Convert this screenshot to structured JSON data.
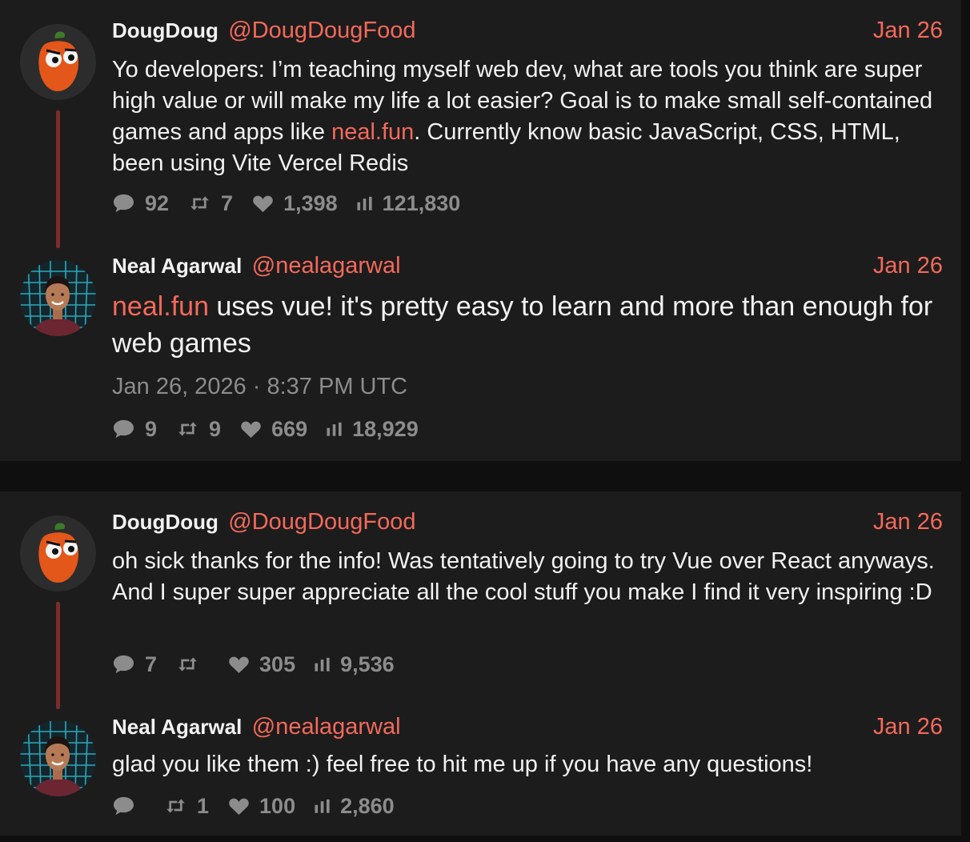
{
  "colors": {
    "background": "#0f0f0f",
    "card": "#1c1c1c",
    "accent": "#f4695b",
    "muted": "#8c8c8c",
    "thread_line": "#7d2b2b"
  },
  "icons": {
    "reply": "speech-bubble-icon",
    "retweet": "retweet-icon",
    "like": "heart-icon",
    "views": "bar-chart-icon"
  },
  "threads": [
    {
      "tweets": [
        {
          "fullname": "DougDoug",
          "handle": "@DougDougFood",
          "date": "Jan 26",
          "content": {
            "before": "Yo developers: I’m teaching myself web dev, what are tools you think are super high value or will make my life a lot easier? Goal is to make small self-contained games and apps like ",
            "link": "neal.fun",
            "after": ". Currently know basic JavaScript, CSS, HTML, been using Vite Vercel Redis"
          },
          "stats": {
            "replies": "92",
            "retweets": "7",
            "likes": "1,398",
            "views": "121,830"
          }
        },
        {
          "fullname": "Neal Agarwal",
          "handle": "@nealagarwal",
          "date": "Jan 26",
          "content": {
            "link": "neal.fun",
            "after": " uses vue! it's pretty easy to learn and more than enough for web games"
          },
          "published": "Jan 26, 2026 · 8:37 PM UTC",
          "stats": {
            "replies": "9",
            "retweets": "9",
            "likes": "669",
            "views": "18,929"
          }
        }
      ]
    },
    {
      "tweets": [
        {
          "fullname": "DougDoug",
          "handle": "@DougDougFood",
          "date": "Jan 26",
          "content": {
            "text": "oh sick thanks for the info! Was tentatively going to try Vue over React anyways. And I super super appreciate all the cool stuff you make I find it very inspiring :D"
          },
          "stats": {
            "replies": "7",
            "retweets": "",
            "likes": "305",
            "views": "9,536"
          }
        },
        {
          "fullname": "Neal Agarwal",
          "handle": "@nealagarwal",
          "date": "Jan 26",
          "content": {
            "text": "glad you like them :) feel free to hit me up if you have any questions!"
          },
          "stats": {
            "replies": "",
            "retweets": "1",
            "likes": "100",
            "views": "2,860"
          }
        }
      ]
    }
  ]
}
